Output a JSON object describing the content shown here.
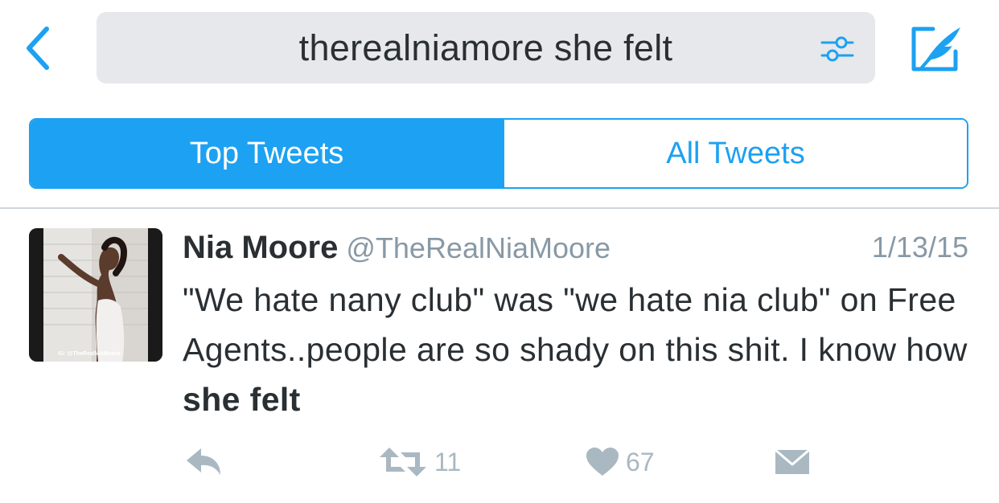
{
  "colors": {
    "accent": "#1da1f2",
    "muted": "#8899a6",
    "icon_muted": "#aab8c2",
    "search_bg": "#e6e8eb"
  },
  "header": {
    "back_icon": "chevron-left-icon",
    "search_query": "therealniamore she felt",
    "filter_icon": "filter-sliders-icon",
    "compose_icon": "compose-tweet-icon"
  },
  "tabs": [
    {
      "label": "Top Tweets",
      "selected": true
    },
    {
      "label": "All Tweets",
      "selected": false
    }
  ],
  "tweet": {
    "avatar_caption": "IG: @TheRealNiaMoore",
    "name": "Nia Moore",
    "handle": "@TheRealNiaMoore",
    "date": "1/13/15",
    "text_plain": "\"We hate nany club\" was \"we hate nia club\" on Free Agents..people are so shady on this shit. I know how ",
    "text_bold": "she felt",
    "actions": {
      "reply_icon": "reply-icon",
      "retweet_icon": "retweet-icon",
      "retweet_count": "11",
      "like_icon": "heart-icon",
      "like_count": "67",
      "dm_icon": "envelope-icon"
    }
  }
}
